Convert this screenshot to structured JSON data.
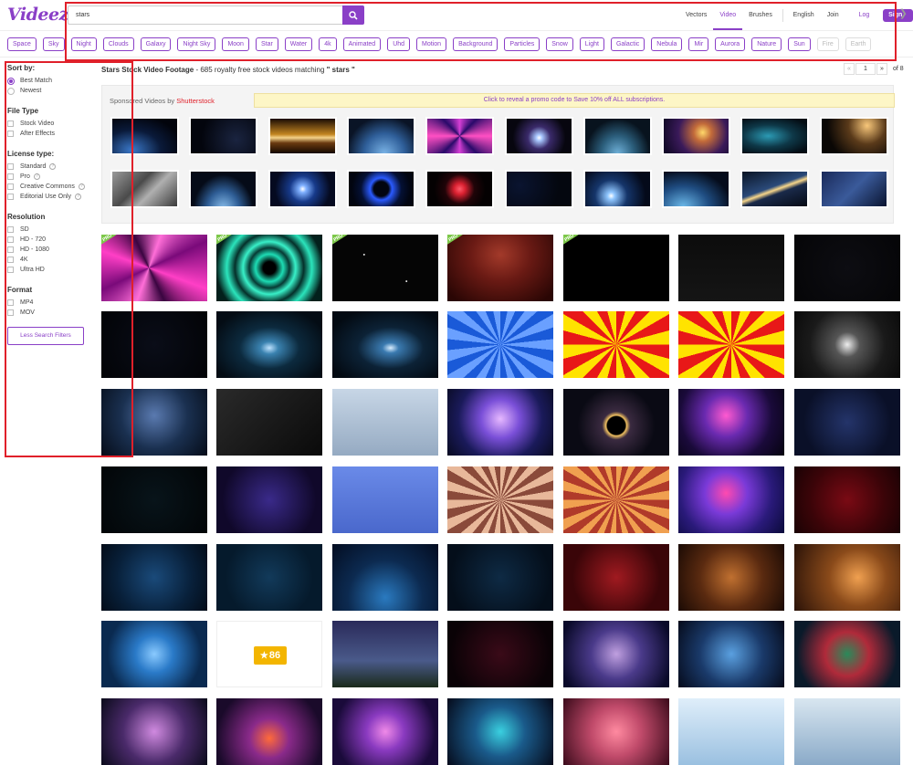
{
  "header": {
    "logo": "Videezy",
    "search_value": "stars",
    "nav": {
      "vectors": "Vectors",
      "video": "Video",
      "brushes": "Brushes",
      "language": "English",
      "join_pro": "Join Pro",
      "login": "Log in",
      "signup": "Sign up"
    }
  },
  "tags": [
    "Space",
    "Sky",
    "Night",
    "Clouds",
    "Galaxy",
    "Night Sky",
    "Moon",
    "Star",
    "Water",
    "4k",
    "Animated",
    "Uhd",
    "Motion",
    "Background",
    "Particles",
    "Snow",
    "Light",
    "Galactic",
    "Nebula",
    "Mir",
    "Aurora",
    "Nature",
    "Sun",
    "Fire",
    "Earth"
  ],
  "sidebar": {
    "sort_title": "Sort by:",
    "sort_best": "Best Match",
    "sort_newest": "Newest",
    "filetype_title": "File Type",
    "ft_stock": "Stock Video",
    "ft_ae": "After Effects",
    "license_title": "License type:",
    "lic_standard": "Standard",
    "lic_pro": "Pro",
    "lic_cc": "Creative Commons",
    "lic_editorial": "Editorial Use Only",
    "res_title": "Resolution",
    "res_sd": "SD",
    "res_720": "HD - 720",
    "res_1080": "HD - 1080",
    "res_4k": "4K",
    "res_uhd": "Ultra HD",
    "format_title": "Format",
    "fmt_mp4": "MP4",
    "fmt_mov": "MOV",
    "less_filters": "Less Search Filters"
  },
  "results": {
    "title": "Stars Stock Video Footage",
    "summary": " - 685 royalty free stock videos matching ",
    "query": "\" stars \"",
    "page": "1",
    "of_pages": "of 8",
    "prev": "«",
    "next": "»"
  },
  "sponsored": {
    "label": "Sponsored Videos by ",
    "brand": "Shutterstock",
    "promo": "Click to reveal a promo code to Save 10% off ALL subscriptions."
  },
  "badge_86": "86",
  "pro_badge": "PRO",
  "colors": {
    "accent": "#8a3fc7",
    "highlight": "#e0202a"
  }
}
